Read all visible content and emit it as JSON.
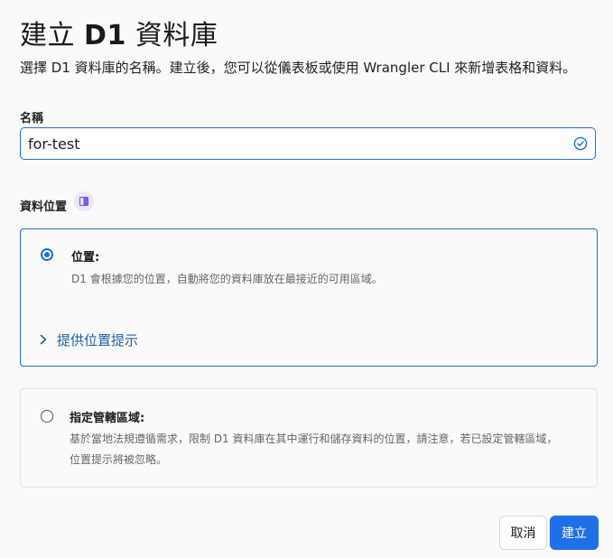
{
  "header": {
    "title_prefix": "建立 ",
    "title_bold": "D1",
    "title_suffix": " 資料庫",
    "subtitle": "選擇 D1 資料庫的名稱。建立後，您可以從儀表板或使用 Wrangler CLI 來新增表格和資料。"
  },
  "name_field": {
    "label": "名稱",
    "value": "for-test",
    "status_icon": "check-circle-icon"
  },
  "location": {
    "label": "資料位置",
    "doc_icon": "book-icon",
    "options": [
      {
        "title": "位置:",
        "description": "D1 會根據您的位置，自動將您的資料庫放在最接近的可用區域。",
        "selected": true,
        "hint_link": "提供位置提示"
      },
      {
        "title": "指定管轄區域:",
        "description": "基於當地法規遵循需求，限制 D1 資料庫在其中運行和儲存資料的位置，請注意，若已設定管轄區域，位置提示將被忽略。",
        "selected": false
      }
    ]
  },
  "actions": {
    "cancel_label": "取消",
    "create_label": "建立"
  },
  "colors": {
    "accent": "#1f6fe8",
    "link": "#1f5fa8",
    "badge_bg": "#ece6fb"
  }
}
